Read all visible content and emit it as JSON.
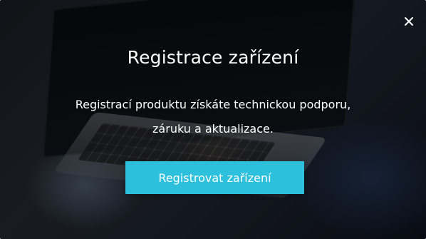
{
  "modal": {
    "title": "Registrace zařízení",
    "description_line1": "Registrací produktu získáte technickou podporu,",
    "description_line2": "záruku a aktualizace.",
    "cta_label": "Registrovat zařízení",
    "accent_color": "#2dc0dc",
    "close_icon": "close-icon"
  }
}
